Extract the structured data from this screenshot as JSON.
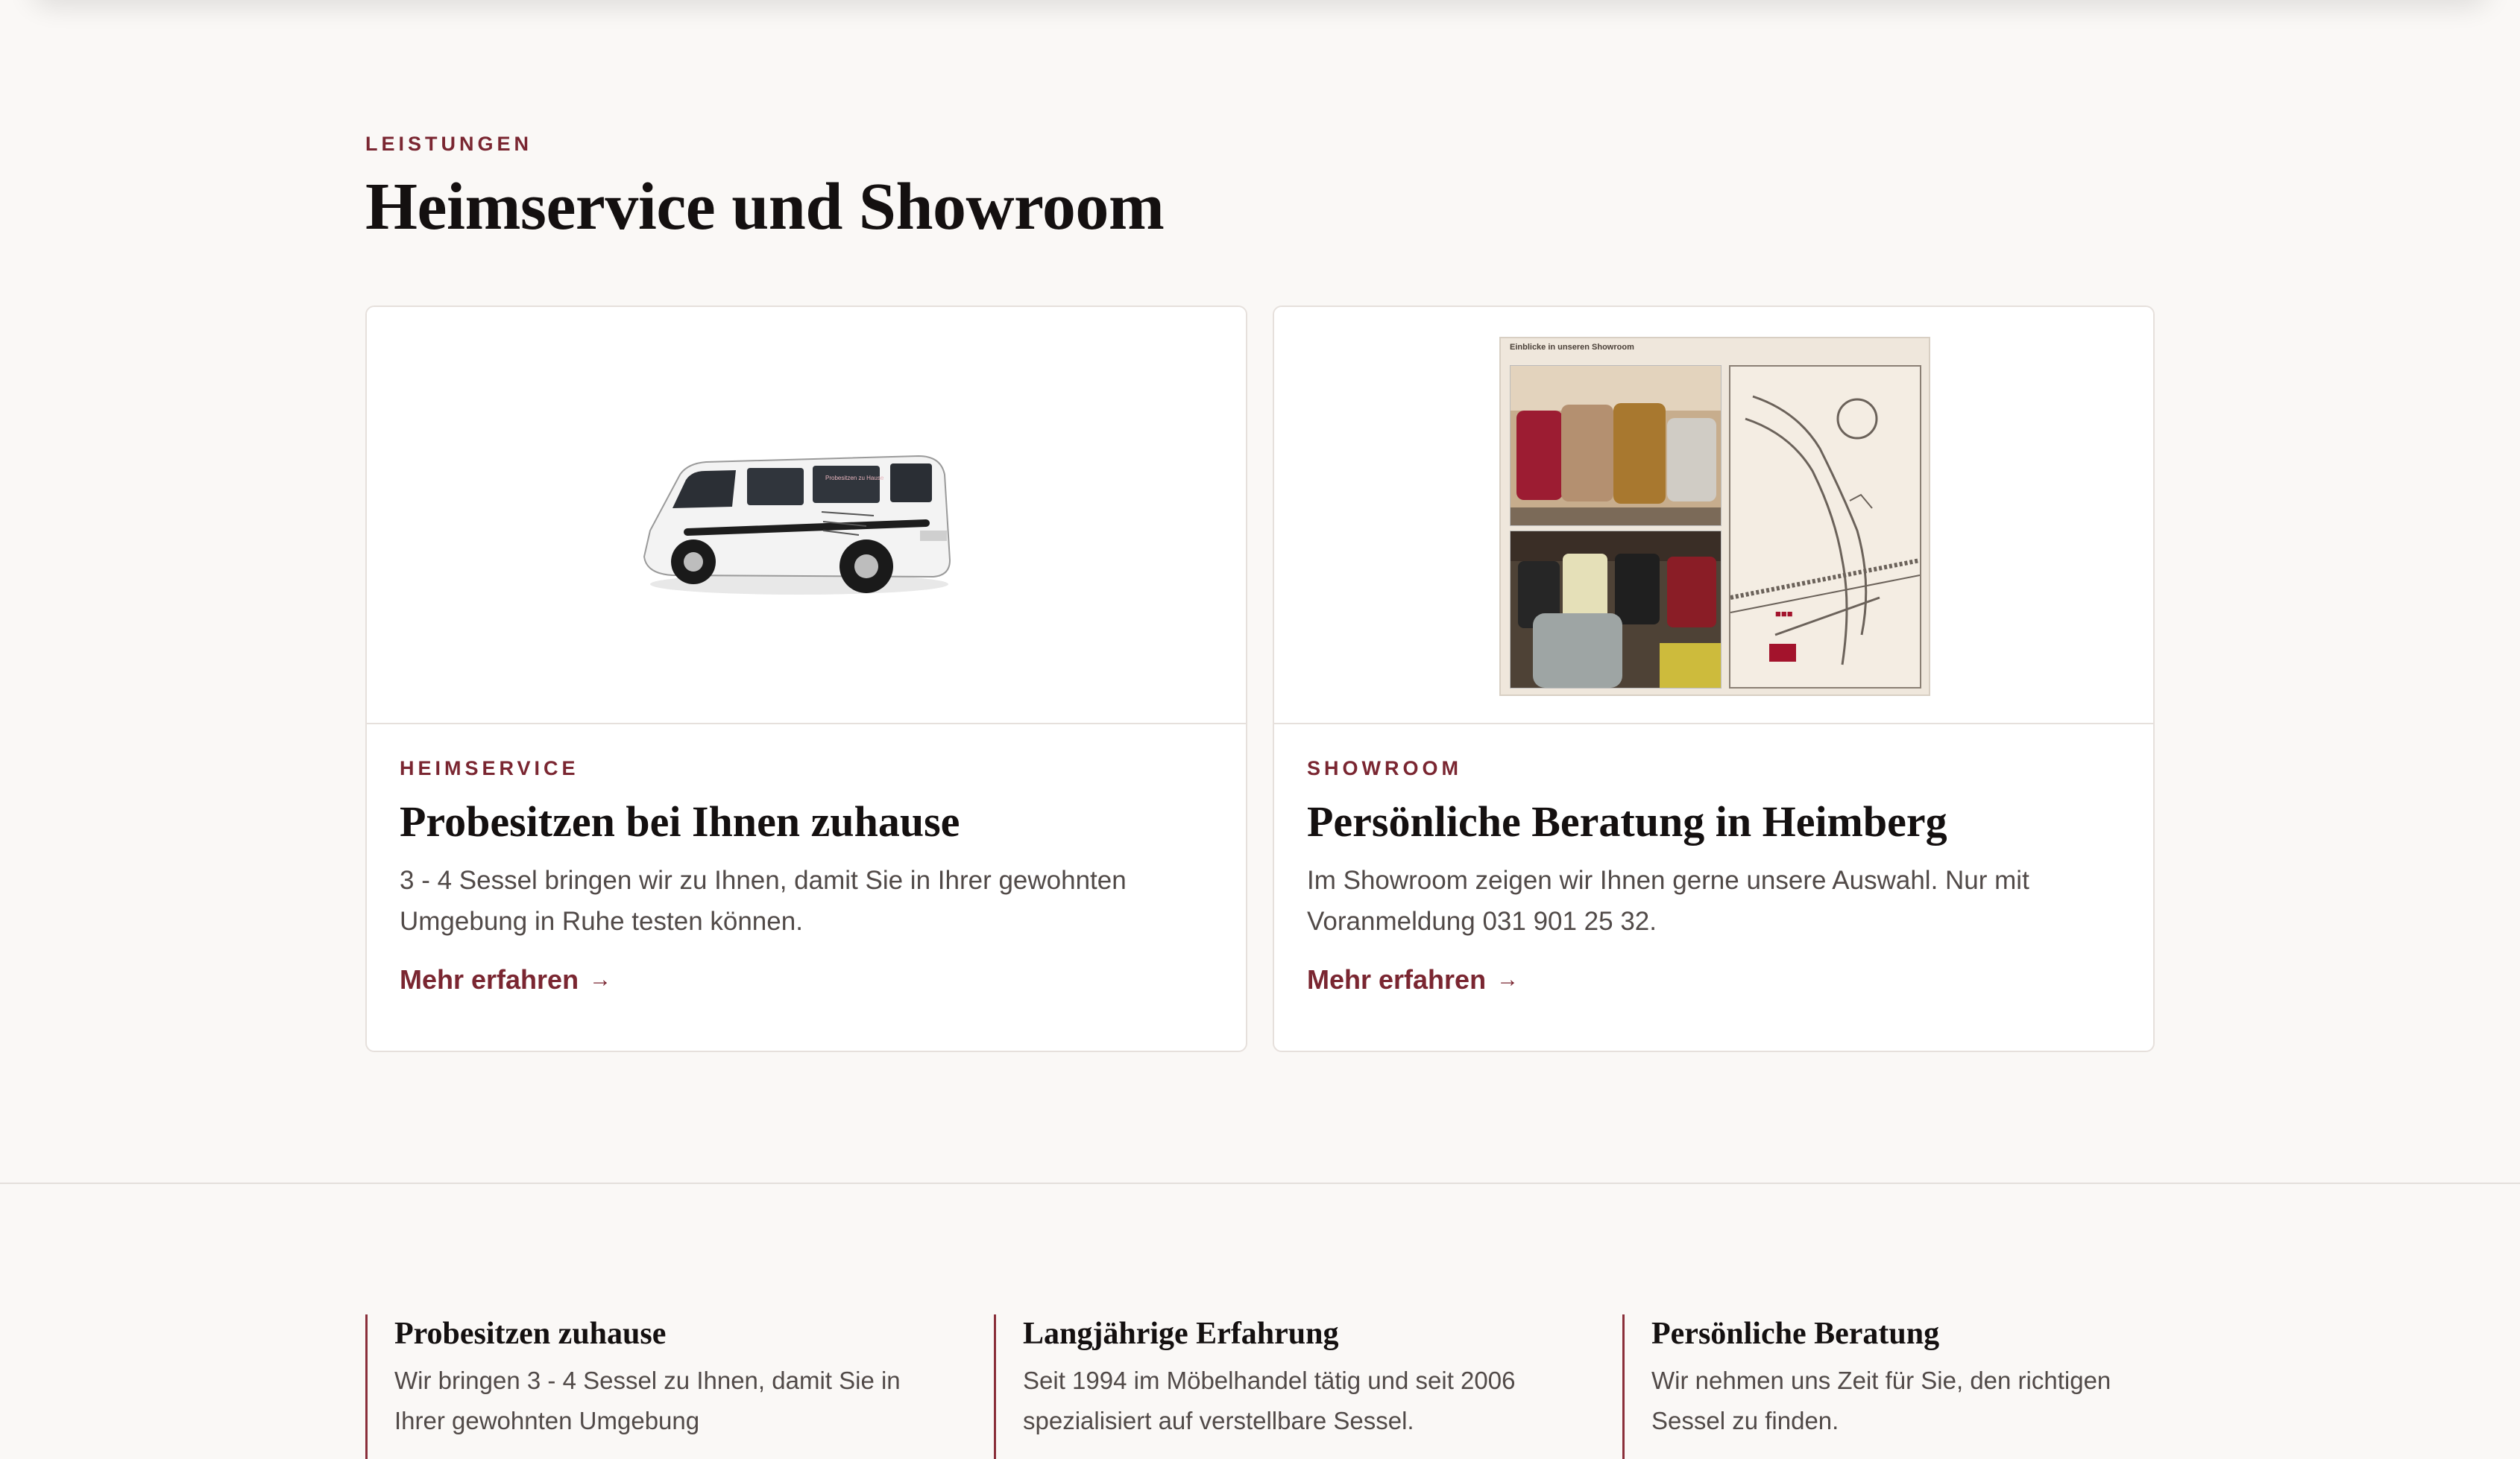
{
  "services": {
    "eyebrow": "LEISTUNGEN",
    "title": "Heimservice und Showroom",
    "cards": [
      {
        "eyebrow": "HEIMSERVICE",
        "title": "Probesitzen bei Ihnen zuhause",
        "text": "3 - 4 Sessel bringen wir zu Ihnen, damit Sie in Ihrer gewohnten Umgebung in Ruhe testen können.",
        "link": "Mehr erfahren",
        "arrow": "→",
        "image": "white-van-image",
        "image_text": "Probesitzen zu Hause"
      },
      {
        "eyebrow": "SHOWROOM",
        "title": "Persönliche Beratung in Heimberg",
        "text": "Im Showroom zeigen wir Ihnen gerne unsere Auswahl. Nur mit Voranmeldung 031 901 25 32.",
        "link": "Mehr erfahren",
        "arrow": "→",
        "image": "showroom-flyer-image",
        "image_caption": "Einblicke in unseren Showroom"
      }
    ]
  },
  "features": [
    {
      "title": "Probesitzen zuhause",
      "text": "Wir bringen 3 - 4 Sessel zu Ihnen, damit Sie in Ihrer gewohnten Umgebung"
    },
    {
      "title": "Langjährige Erfahrung",
      "text": "Seit 1994 im Möbelhandel tätig und seit 2006 spezialisiert auf verstellbare Sessel."
    },
    {
      "title": "Persönliche Beratung",
      "text": "Wir nehmen uns Zeit für Sie, den richtigen Sessel zu finden."
    }
  ],
  "colors": {
    "accent": "#7a2631",
    "background": "#faf8f6",
    "card": "#ffffff",
    "border": "#e6e0dc",
    "text": "#514a48"
  }
}
